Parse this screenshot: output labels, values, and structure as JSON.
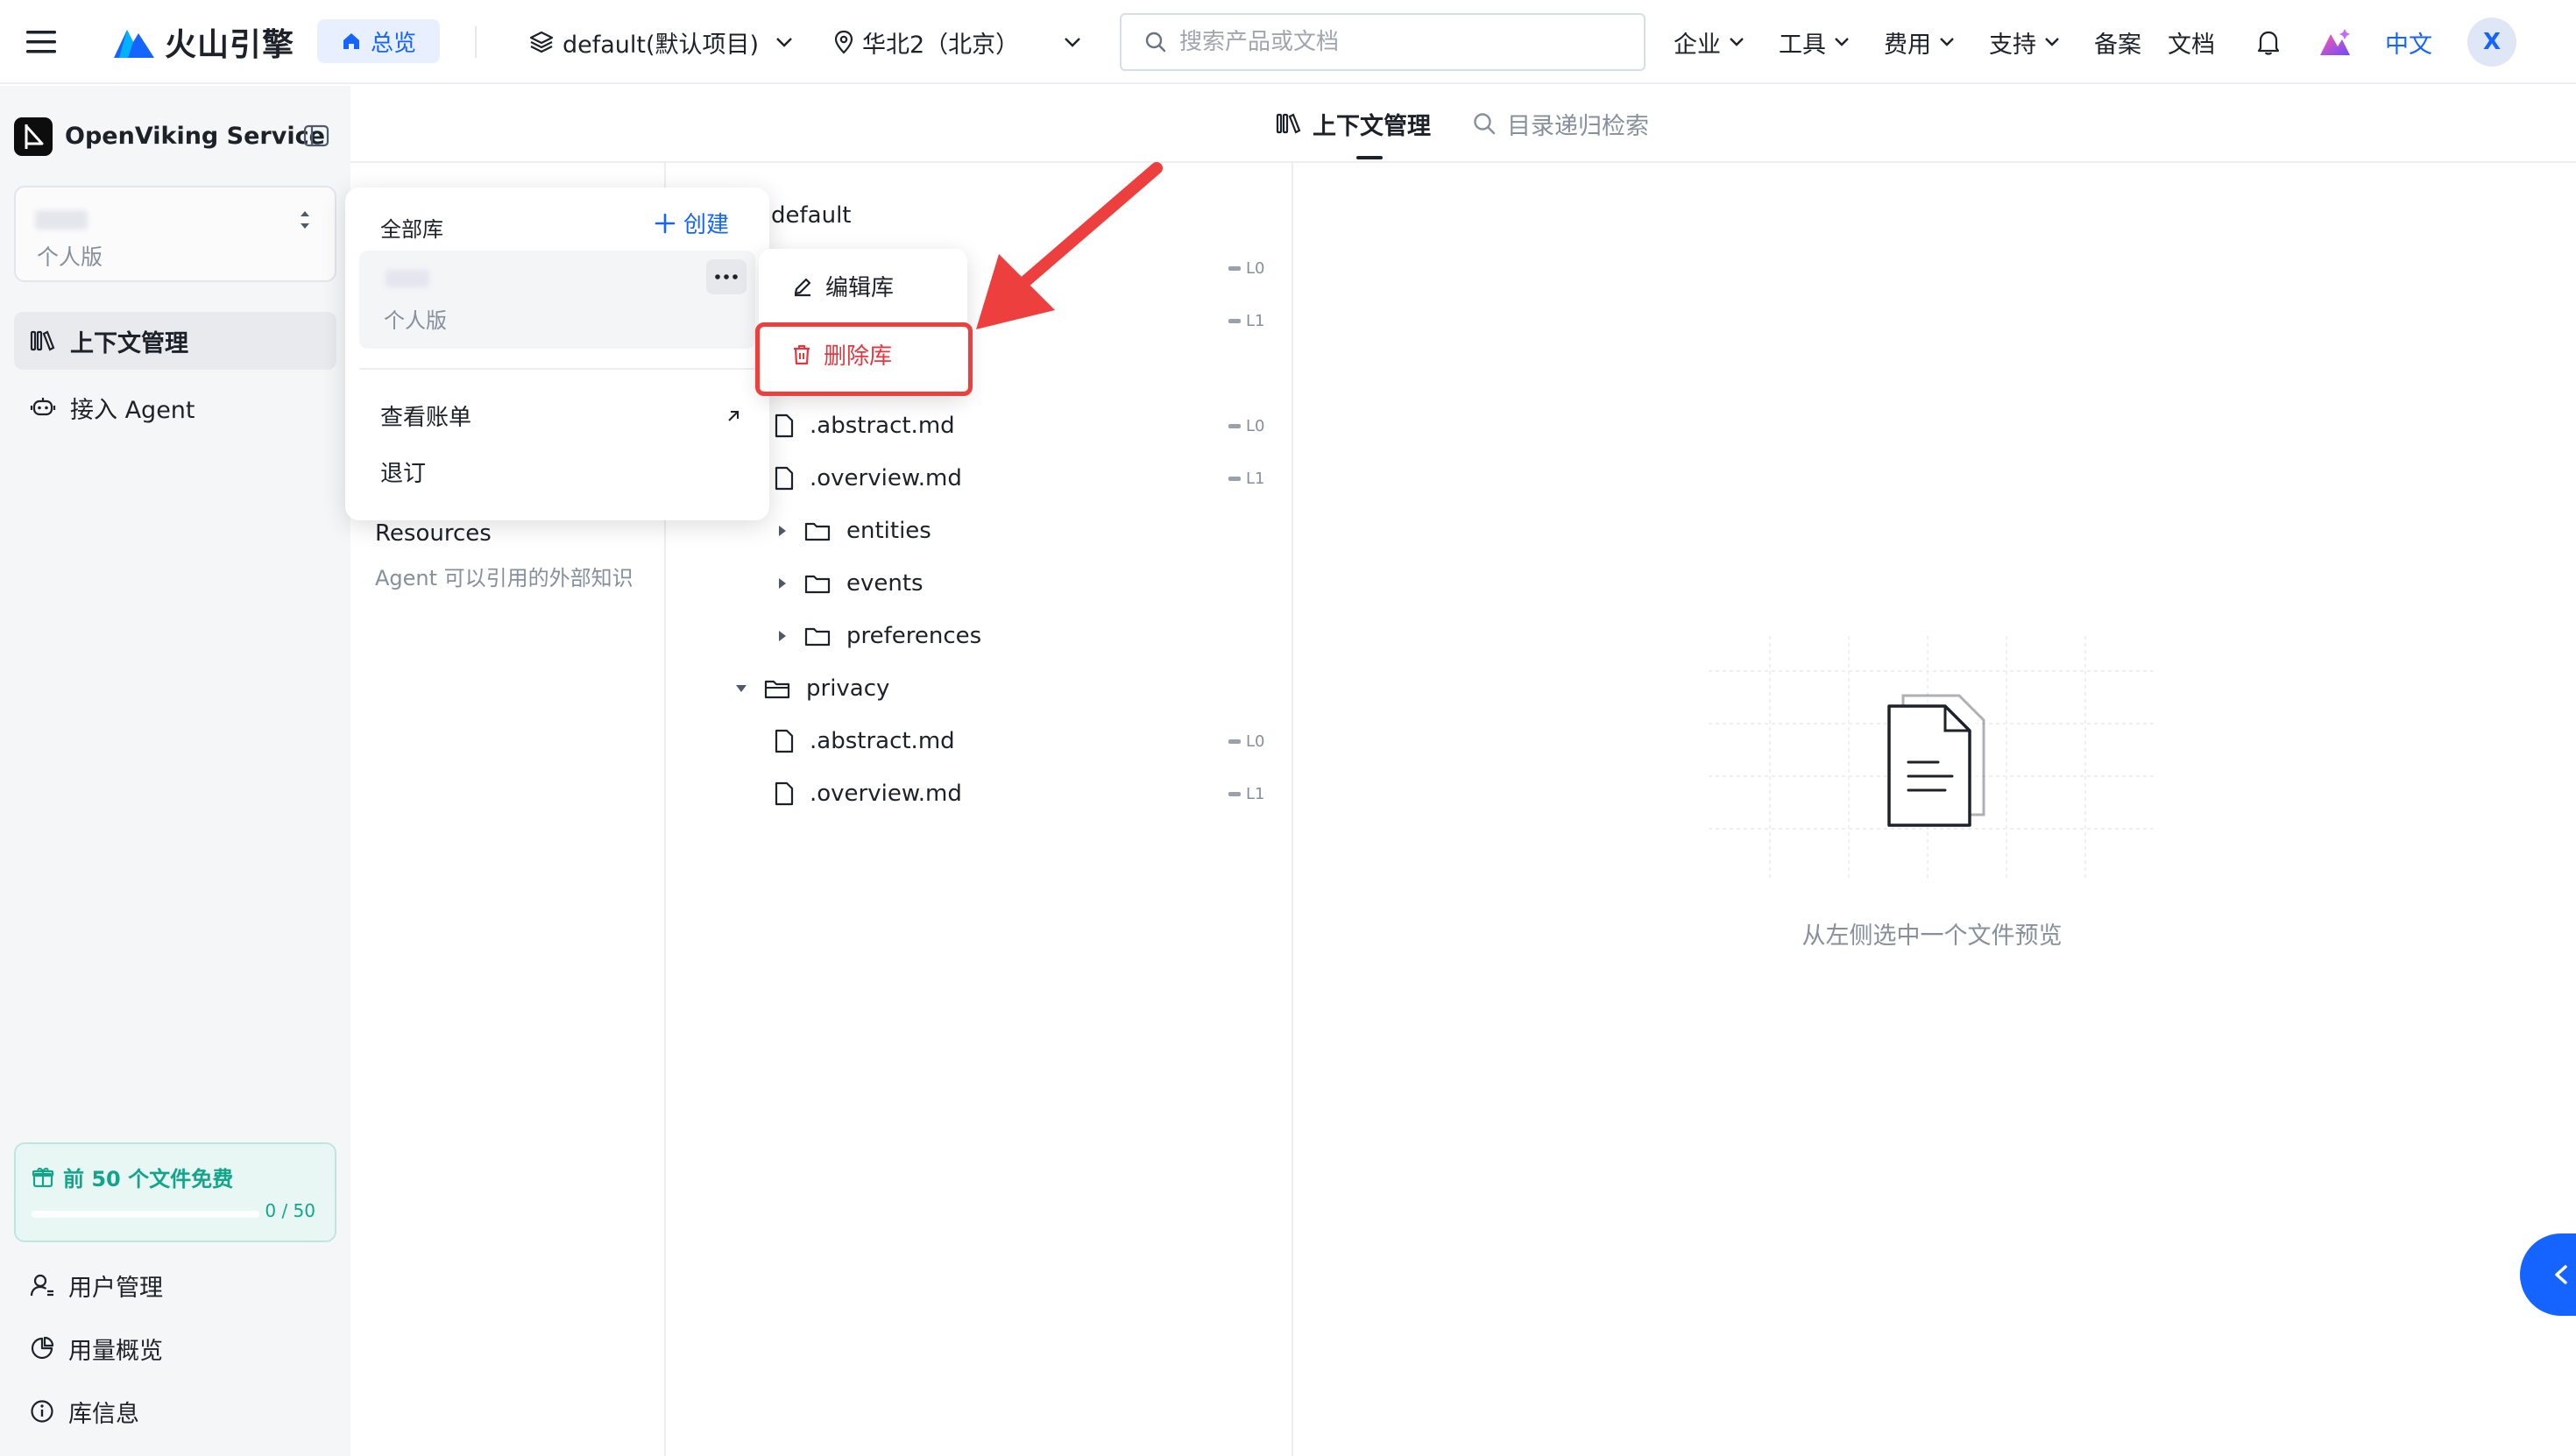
{
  "topbar": {
    "brand": "火山引擎",
    "overview": "总览",
    "project": "default(默认项目)",
    "region": "华北2（北京）",
    "search_placeholder": "搜索产品或文档",
    "nav": [
      "企业",
      "工具",
      "费用",
      "支持"
    ],
    "links": [
      "备案",
      "文档"
    ],
    "language": "中文",
    "avatar": "X"
  },
  "sidebar": {
    "service_name": "OpenViking Service",
    "library_edition": "个人版",
    "items": [
      {
        "label": "上下文管理",
        "icon": "library-icon",
        "active": true
      },
      {
        "label": "接入 Agent",
        "icon": "agent-icon",
        "active": false
      }
    ],
    "free_quota": {
      "label": "前 50 个文件免费",
      "progress": "0 / 50",
      "used": 0,
      "total": 50
    },
    "bottom_items": [
      {
        "label": "用户管理",
        "icon": "user-icon"
      },
      {
        "label": "用量概览",
        "icon": "pie-chart-icon"
      },
      {
        "label": "库信息",
        "icon": "info-icon"
      }
    ]
  },
  "tabs": [
    {
      "label": "上下文管理",
      "active": true
    },
    {
      "label": "目录递归检索",
      "active": false
    }
  ],
  "left_pane": {
    "resources_title": "Resources",
    "resources_desc": "Agent 可以引用的外部知识"
  },
  "tree": {
    "root": "default",
    "rows": [
      {
        "name": ".abstract.md",
        "level": "L0"
      },
      {
        "name": ".overview.md",
        "level": "L1"
      },
      {
        "name": "entities"
      },
      {
        "name": "events"
      },
      {
        "name": "preferences"
      },
      {
        "name": "privacy"
      },
      {
        "name": ".abstract.md",
        "level": "L0"
      },
      {
        "name": ".overview.md",
        "level": "L1"
      }
    ],
    "hidden_levels": [
      "L0",
      "L1"
    ]
  },
  "preview": {
    "empty_text": "从左侧选中一个文件预览"
  },
  "library_popover": {
    "title": "全部库",
    "create": "创建",
    "library_edition": "个人版",
    "view_bill": "查看账单",
    "unsubscribe": "退订"
  },
  "library_menu": {
    "edit": "编辑库",
    "delete": "删除库"
  },
  "colors": {
    "accent": "#1664ff",
    "danger": "#e8363f",
    "annotation": "#ee3f3f",
    "free_green": "#12a58a"
  }
}
